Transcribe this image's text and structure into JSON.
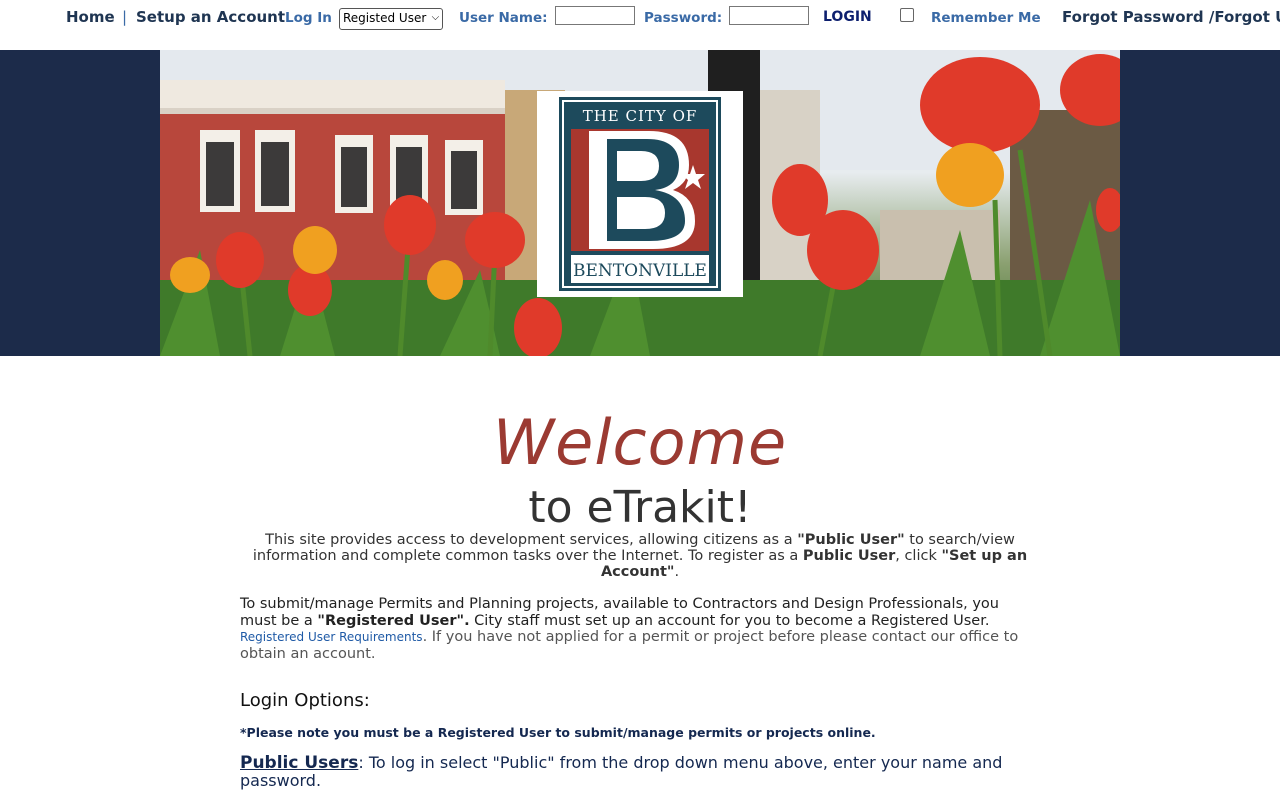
{
  "nav": {
    "home": "Home",
    "separator": "|",
    "setup_account": "Setup an Account",
    "log_in": "Log In",
    "user_type_selected": "Registed User",
    "user_name_label": "User Name:",
    "user_name_value": "",
    "password_label": "Password:",
    "password_value": "",
    "login_button": "LOGIN",
    "remember_me": "Remember Me",
    "forgot": "Forgot Password /Forgot Us"
  },
  "logo": {
    "line1": "THE CITY OF",
    "letter": "B",
    "line2": "BENTONVILLE"
  },
  "main": {
    "welcome": "Welcome",
    "subtitle": "to eTrakit!",
    "intro": {
      "t1": "This site provides access to development services, allowing citizens as a ",
      "b1": "\"Public User\"",
      "t2": " to search/view information and complete common tasks over the Internet. To register as a ",
      "b2": "Public User",
      "t3": ", click ",
      "b3": "\"Set up an Account\"",
      "t4": "."
    },
    "registered": {
      "t1": "To submit/manage Permits and Planning projects, available to Contractors and Design Professionals, you must be a ",
      "b1": "\"Registered User\".",
      "t2": " City staff must set up an account for you to become a Registered User. ",
      "link": "Registered User Requirements",
      "t3": ". If you have not applied for a permit or project before please contact our office to obtain an account."
    },
    "login_options_heading": "Login Options:",
    "note": "*Please note you must be a Registered User to submit/manage permits or projects online.",
    "public_users_link": "Public Users",
    "public_users_text": ": To log in select \"Public\" from the drop down menu above, enter your name and password."
  },
  "colors": {
    "navy": "#1c2b4a",
    "welcome_red": "#9b3a32",
    "link_blue": "#3a6aa6",
    "logo_teal": "#1d4a5c",
    "logo_red": "#a8372e"
  }
}
